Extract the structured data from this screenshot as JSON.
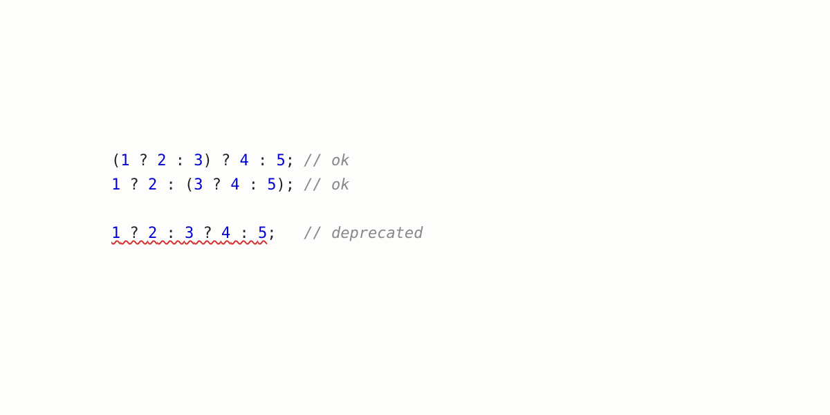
{
  "code": {
    "line1": {
      "t0": "(",
      "t1": "1",
      "t2": " ? ",
      "t3": "2",
      "t4": " : ",
      "t5": "3",
      "t6": ") ? ",
      "t7": "4",
      "t8": " : ",
      "t9": "5",
      "t10": ";",
      "t11": " ",
      "comment": "// ok"
    },
    "line2": {
      "t0": "1",
      "t1": " ? ",
      "t2": "2",
      "t3": " : (",
      "t4": "3",
      "t5": " ? ",
      "t6": "4",
      "t7": " : ",
      "t8": "5",
      "t9": ");",
      "t10": " ",
      "comment": "// ok"
    },
    "line3": {
      "t0": "1",
      "t1": " ? ",
      "t2": "2",
      "t3": " : ",
      "t4": "3",
      "t5": " ? ",
      "t6": "4",
      "t7": " : ",
      "t8": "5",
      "t9": ";",
      "t10": "   ",
      "comment": "// deprecated"
    }
  }
}
